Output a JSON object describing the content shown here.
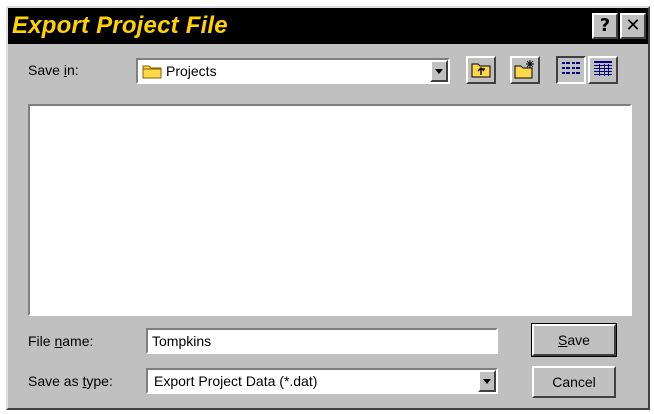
{
  "dialog": {
    "title": "Export Project File",
    "help_button": "?",
    "close_button": "✕"
  },
  "save_in": {
    "label_pre": "Save ",
    "label_access": "i",
    "label_post": "n:",
    "value": "Projects"
  },
  "file_name": {
    "label_pre": "File ",
    "label_access": "n",
    "label_post": "ame:",
    "value": "Tompkins"
  },
  "save_as_type": {
    "label_pre": "Save as ",
    "label_access": "t",
    "label_post": "ype:",
    "value": "Export Project Data (*.dat)"
  },
  "buttons": {
    "save_access": "S",
    "save_rest": "ave",
    "cancel": "Cancel"
  },
  "colors": {
    "title_bar": "#000000",
    "title_text": "#ffd200",
    "face": "#c0c0c0",
    "folder": "#ffd84a"
  }
}
